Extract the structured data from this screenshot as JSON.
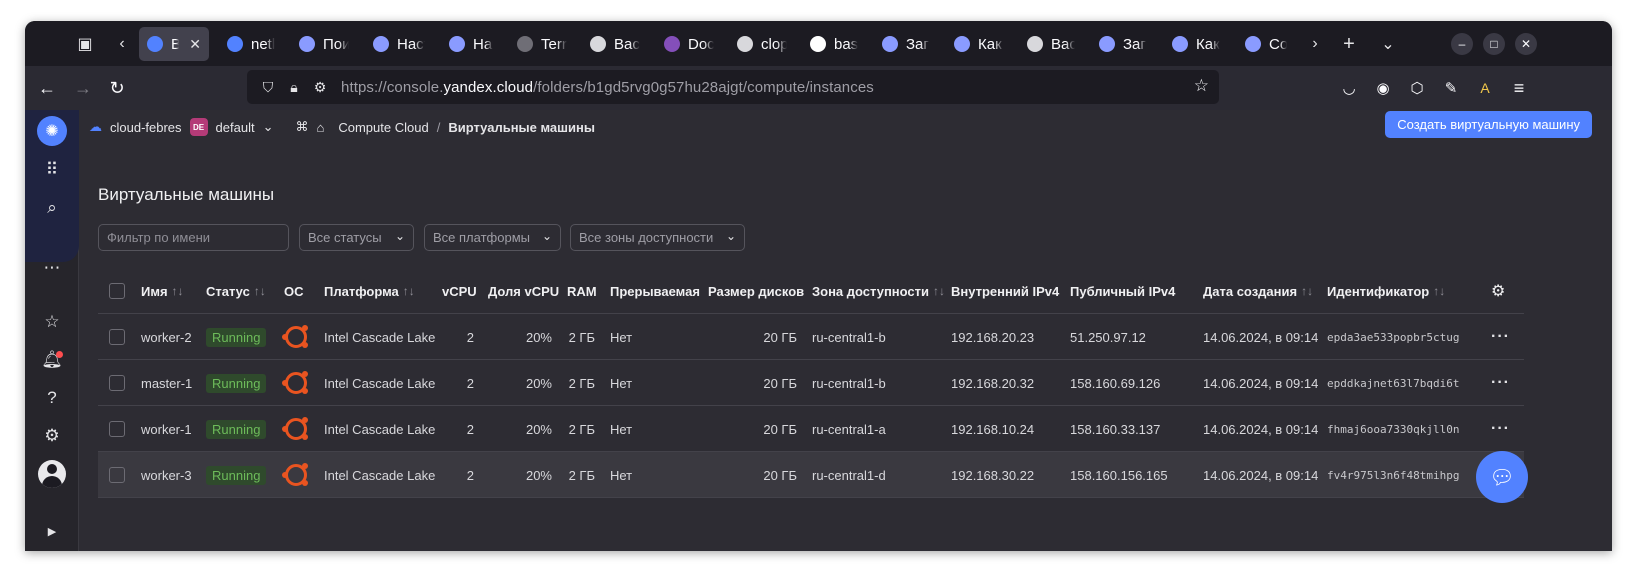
{
  "browser": {
    "tabs": [
      {
        "label": "Виртуальные машины",
        "favicon": "yandex-cloud-icon",
        "fav_color": "#5282ff",
        "active": true
      },
      {
        "label": "netlify",
        "favicon": "netlify-icon",
        "fav_color": "#5282ff"
      },
      {
        "label": "Поиск",
        "favicon": "page-icon",
        "fav_color": "#8a9bff"
      },
      {
        "label": "Настройка",
        "favicon": "page-icon",
        "fav_color": "#8a9bff"
      },
      {
        "label": "Начало",
        "favicon": "page-icon",
        "fav_color": "#8a9bff"
      },
      {
        "label": "Terraform",
        "favicon": "terraform-icon",
        "fav_color": "#6f6e76"
      },
      {
        "label": "Backend",
        "favicon": "hashicorp-icon",
        "fav_color": "#d8d8dc"
      },
      {
        "label": "Docs",
        "favicon": "terraform-docs-icon",
        "fav_color": "#844fba"
      },
      {
        "label": "clopro",
        "favicon": "github-icon",
        "fav_color": "#d8d8dc"
      },
      {
        "label": "base",
        "favicon": "google-icon",
        "fav_color": "#ffffff"
      },
      {
        "label": "Загрузка",
        "favicon": "page-icon",
        "fav_color": "#8a9bff"
      },
      {
        "label": "Как создать",
        "favicon": "page-icon",
        "fav_color": "#8a9bff"
      },
      {
        "label": "Backend",
        "favicon": "hashicorp-icon",
        "fav_color": "#d8d8dc"
      },
      {
        "label": "Загрузка",
        "favicon": "page-icon",
        "fav_color": "#8a9bff"
      },
      {
        "label": "Как создать",
        "favicon": "page-icon",
        "fav_color": "#8a9bff"
      },
      {
        "label": "Создание",
        "favicon": "page-icon",
        "fav_color": "#8a9bff"
      }
    ],
    "url_prefix": "https://console.",
    "url_domain": "yandex.cloud",
    "url_path": "/folders/b1gd5rvg0g57hu28ajgt/compute/instances"
  },
  "header": {
    "cloud": "cloud-febres",
    "folder_badge": "DE",
    "folder": "default",
    "breadcrumb_service": "Compute Cloud",
    "breadcrumb_sep": "/",
    "breadcrumb_page": "Виртуальные машины",
    "create_button": "Создать виртуальную машину"
  },
  "page": {
    "title": "Виртуальные машины"
  },
  "filters": {
    "name_placeholder": "Фильтр по имени",
    "status": "Все статусы",
    "platform": "Все платформы",
    "zone": "Все зоны доступности"
  },
  "table": {
    "columns": {
      "name": "Имя",
      "status": "Статус",
      "os": "ОС",
      "platform": "Платформа",
      "vcpu": "vCPU",
      "vcpu_share": "Доля vCPU",
      "ram": "RAM",
      "preemptible": "Прерываемая",
      "disk": "Размер дисков",
      "zone": "Зона доступности",
      "internal_ip": "Внутренний IPv4",
      "public_ip": "Публичный IPv4",
      "created": "Дата создания",
      "id": "Идентификатор"
    },
    "sort_glyph": "↑↓",
    "rows": [
      {
        "name": "worker-2",
        "status": "Running",
        "platform": "Intel Cascade Lake",
        "vcpu": "2",
        "vcpu_share": "20%",
        "ram": "2 ГБ",
        "preemptible": "Нет",
        "disk": "20 ГБ",
        "zone": "ru-central1-b",
        "internal_ip": "192.168.20.23",
        "public_ip": "51.250.97.12",
        "created": "14.06.2024, в 09:14",
        "id": "epda3ae533popbr5ctug"
      },
      {
        "name": "master-1",
        "status": "Running",
        "platform": "Intel Cascade Lake",
        "vcpu": "2",
        "vcpu_share": "20%",
        "ram": "2 ГБ",
        "preemptible": "Нет",
        "disk": "20 ГБ",
        "zone": "ru-central1-b",
        "internal_ip": "192.168.20.32",
        "public_ip": "158.160.69.126",
        "created": "14.06.2024, в 09:14",
        "id": "epddkajnet63l7bqdi6t"
      },
      {
        "name": "worker-1",
        "status": "Running",
        "platform": "Intel Cascade Lake",
        "vcpu": "2",
        "vcpu_share": "20%",
        "ram": "2 ГБ",
        "preemptible": "Нет",
        "disk": "20 ГБ",
        "zone": "ru-central1-a",
        "internal_ip": "192.168.10.24",
        "public_ip": "158.160.33.137",
        "created": "14.06.2024, в 09:14",
        "id": "fhmaj6ooa7330qkjll0n"
      },
      {
        "name": "worker-3",
        "status": "Running",
        "platform": "Intel Cascade Lake",
        "vcpu": "2",
        "vcpu_share": "20%",
        "ram": "2 ГБ",
        "preemptible": "Нет",
        "disk": "20 ГБ",
        "zone": "ru-central1-d",
        "internal_ip": "192.168.30.22",
        "public_ip": "158.160.156.165",
        "created": "14.06.2024, в 09:14",
        "id": "fv4r975l3n6f48tmihpg"
      }
    ]
  },
  "colors": {
    "accent": "#5282ff",
    "running_bg": "#2f4a2c",
    "running_fg": "#6dbb5a",
    "ubuntu": "#e95420"
  }
}
